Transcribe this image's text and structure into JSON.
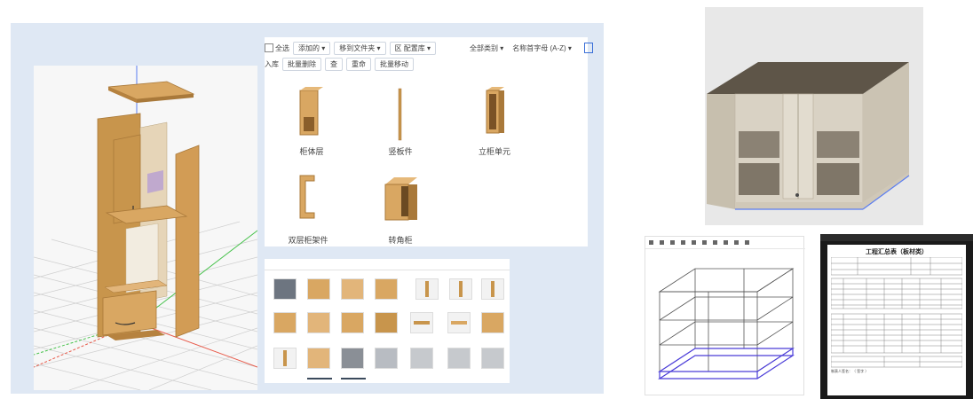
{
  "toolbar": {
    "row1": {
      "select_all": "全选",
      "add_folder": "添加的",
      "move_to_folder": "移到文件夹",
      "default_config": "区 配置库",
      "filter_all": "全部类别",
      "sort_by_name": "名称首字母 (A-Z)"
    },
    "row2": {
      "import": "入库",
      "batch_delete": "批量删除",
      "view": "查",
      "rename": "重命",
      "batch_move": "批量移动"
    }
  },
  "library_items": [
    {
      "label": "柜体层",
      "icon": "open-shelf-cabinet-icon"
    },
    {
      "label": "竖板件",
      "icon": "vertical-panel-icon"
    },
    {
      "label": "立柜单元",
      "icon": "tall-cabinet-icon"
    },
    {
      "label": "双层柜架件",
      "icon": "c-frame-icon"
    },
    {
      "label": "转角柜",
      "icon": "corner-cabinet-icon"
    }
  ],
  "report": {
    "title": "工程汇总表（板材类）",
    "footer": "制表人签名：（ 签字 ）"
  },
  "colors": {
    "wood": "#c8954c",
    "wood_dark": "#a9793a",
    "cabinet_face": "#d9d2c4",
    "cabinet_top": "#5e5548",
    "axis_blue": "#5a7df0",
    "axis_red": "#e85a4a",
    "axis_green": "#47c24c",
    "wire_base": "#4a3cd8"
  }
}
